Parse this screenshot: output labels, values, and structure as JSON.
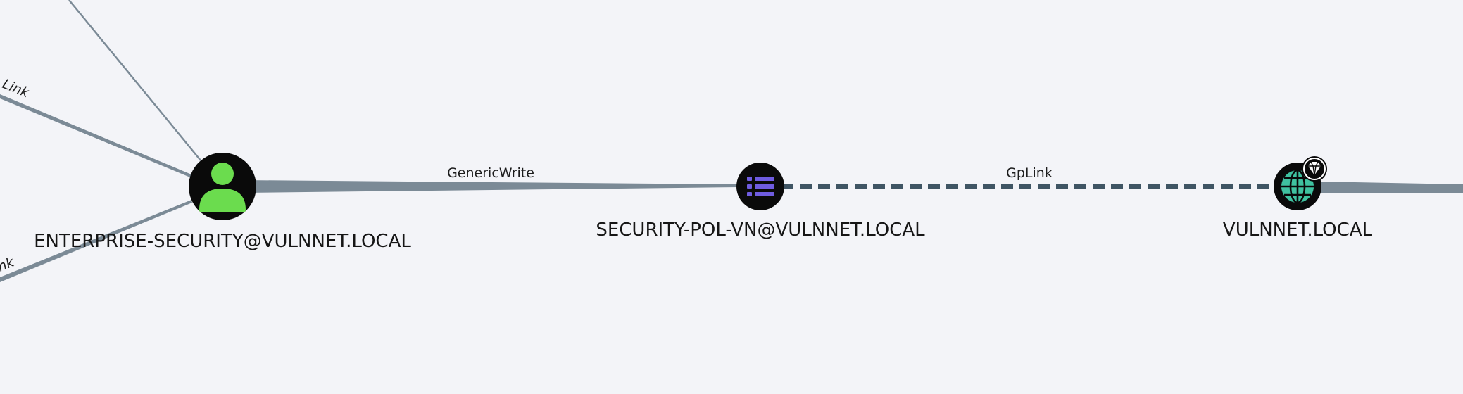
{
  "graph": {
    "nodes": [
      {
        "id": "enterprise-security",
        "label": "ENTERPRISE-SECURITY@VULNNET.LOCAL",
        "type": "user",
        "icon": "user-icon",
        "icon_color": "#6bdc4e"
      },
      {
        "id": "security-pol-vn",
        "label": "SECURITY-POL-VN@VULNNET.LOCAL",
        "type": "gpo",
        "icon": "list-icon",
        "icon_color": "#6f5ce0"
      },
      {
        "id": "vulnnet-local",
        "label": "VULNNET.LOCAL",
        "type": "domain",
        "icon": "globe-icon",
        "icon_color": "#3fc2a0",
        "badge": "diamond-icon"
      }
    ],
    "edges": [
      {
        "from": "enterprise-security",
        "to": "security-pol-vn",
        "label": "GenericWrite",
        "style": "solid"
      },
      {
        "from": "security-pol-vn",
        "to": "vulnnet-local",
        "label": "GpLink",
        "style": "dashed"
      }
    ],
    "partial_edge_labels": [
      {
        "text": "Link"
      },
      {
        "text": "nk"
      }
    ]
  },
  "colors": {
    "background": "#f3f4f8",
    "edge": "#7b8a96",
    "dashed_edge": "#3f5564",
    "node_fill": "#0a0a0a"
  }
}
